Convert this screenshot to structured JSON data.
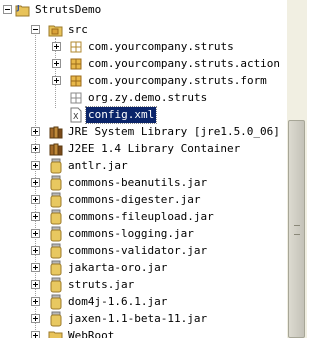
{
  "tree": {
    "project": "StrutsDemo",
    "src_label": "src",
    "packages": [
      "com.yourcompany.struts",
      "com.yourcompany.struts.action",
      "com.yourcompany.struts.form",
      "org.zy.demo.struts"
    ],
    "selected_file": "config.xml",
    "libraries": [
      "JRE System Library [jre1.5.0_06]",
      "J2EE 1.4 Library Container"
    ],
    "jars": [
      "antlr.jar",
      "commons-beanutils.jar",
      "commons-digester.jar",
      "commons-fileupload.jar",
      "commons-logging.jar",
      "commons-validator.jar",
      "jakarta-oro.jar",
      "struts.jar",
      "dom4j-1.6.1.jar",
      "jaxen-1.1-beta-11.jar"
    ],
    "webroot": "WebRoot"
  },
  "colors": {
    "selection": "#0a246a",
    "package": "#c89a2a",
    "jar": "#e8c860",
    "folder": "#e8c35a"
  }
}
